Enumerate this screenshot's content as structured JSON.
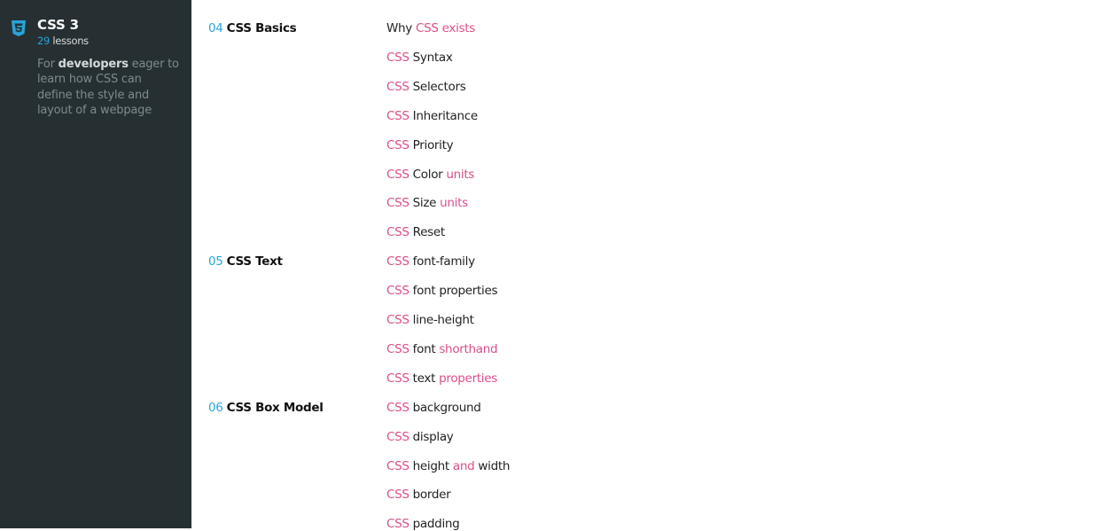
{
  "sidebar": {
    "logo_icon": "css3-shield-icon",
    "title": "CSS 3",
    "lessons_count": "29",
    "lessons_label": "lessons",
    "desc_pre": "For",
    "desc_bold": "developers",
    "desc_post": "eager to learn how CSS can define the style and layout of a webpage"
  },
  "colors": {
    "accent_blue": "#2aa3d9",
    "accent_pink": "#d94f8a",
    "sidebar_bg": "#263032"
  },
  "chapters": [
    {
      "num": "04",
      "title": "CSS Basics"
    },
    {
      "num": "05",
      "title": "CSS Text"
    },
    {
      "num": "06",
      "title": "CSS Box Model"
    }
  ],
  "lessons": [
    [
      {
        "t": "Why ",
        "p": false
      },
      {
        "t": "CSS exists",
        "p": true
      }
    ],
    [
      {
        "t": "CSS",
        "p": true
      },
      {
        "t": " Syntax",
        "p": false
      }
    ],
    [
      {
        "t": "CSS",
        "p": true
      },
      {
        "t": " Selectors",
        "p": false
      }
    ],
    [
      {
        "t": "CSS",
        "p": true
      },
      {
        "t": " Inheritance",
        "p": false
      }
    ],
    [
      {
        "t": "CSS",
        "p": true
      },
      {
        "t": " Priority",
        "p": false
      }
    ],
    [
      {
        "t": "CSS",
        "p": true
      },
      {
        "t": " Color ",
        "p": false
      },
      {
        "t": "units",
        "p": true
      }
    ],
    [
      {
        "t": "CSS",
        "p": true
      },
      {
        "t": " Size ",
        "p": false
      },
      {
        "t": "units",
        "p": true
      }
    ],
    [
      {
        "t": "CSS",
        "p": true
      },
      {
        "t": " Reset",
        "p": false
      }
    ],
    [
      {
        "t": "CSS",
        "p": true
      },
      {
        "t": " font-family",
        "p": false
      }
    ],
    [
      {
        "t": "CSS",
        "p": true
      },
      {
        "t": " font properties",
        "p": false
      }
    ],
    [
      {
        "t": "CSS",
        "p": true
      },
      {
        "t": " line-height",
        "p": false
      }
    ],
    [
      {
        "t": "CSS",
        "p": true
      },
      {
        "t": " font ",
        "p": false
      },
      {
        "t": "shorthand",
        "p": true
      }
    ],
    [
      {
        "t": "CSS",
        "p": true
      },
      {
        "t": " text ",
        "p": false
      },
      {
        "t": "properties",
        "p": true
      }
    ],
    [
      {
        "t": "CSS",
        "p": true
      },
      {
        "t": " background",
        "p": false
      }
    ],
    [
      {
        "t": "CSS",
        "p": true
      },
      {
        "t": " display",
        "p": false
      }
    ],
    [
      {
        "t": "CSS",
        "p": true
      },
      {
        "t": " height ",
        "p": false
      },
      {
        "t": "and",
        "p": true
      },
      {
        "t": " width",
        "p": false
      }
    ],
    [
      {
        "t": "CSS",
        "p": true
      },
      {
        "t": " border",
        "p": false
      }
    ],
    [
      {
        "t": "CSS",
        "p": true
      },
      {
        "t": " padding",
        "p": false
      }
    ]
  ]
}
